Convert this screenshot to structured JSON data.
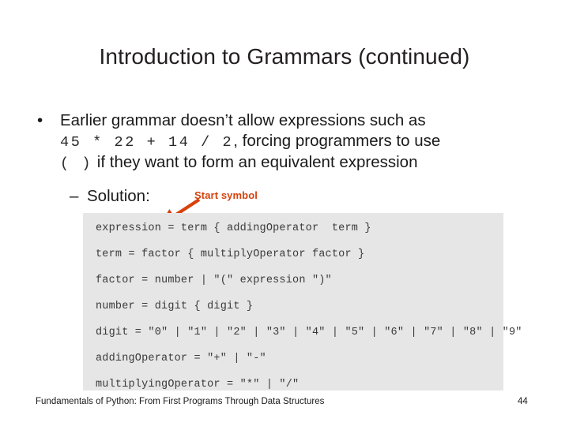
{
  "slide": {
    "title": "Introduction to Grammars (continued)",
    "background_color": "#ffffff"
  },
  "body": {
    "bullet_marker": "•",
    "line1": "Earlier grammar doesn’t allow expressions such as",
    "line2_code": "45 * 22 + 14 / 2",
    "line2_rest": ", forcing programmers to use",
    "line3_code": "( )",
    "line3_rest": " if they want to form an equivalent expression",
    "sub_bullet_marker": "–",
    "sub_bullet_label": "Solution:"
  },
  "annotation": {
    "label": "Start symbol",
    "color": "#d8410c",
    "points_to": "expression"
  },
  "code_block": {
    "background_color": "#e6e6e6",
    "lines": [
      "expression = term { addingOperator  term }",
      "term = factor { multiplyOperator factor }",
      "factor = number | \"(\" expression \")\"",
      "number = digit { digit }",
      "digit = \"0\" | \"1\" | \"2\" | \"3\" | \"4\" | \"5\" | \"6\" | \"7\" | \"8\" | \"9\"",
      "addingOperator = \"+\" | \"-\"",
      "multiplyingOperator = \"*\" | \"/\""
    ]
  },
  "footer": {
    "text": "Fundamentals of Python: From First Programs Through Data Structures",
    "page_number": "44"
  }
}
